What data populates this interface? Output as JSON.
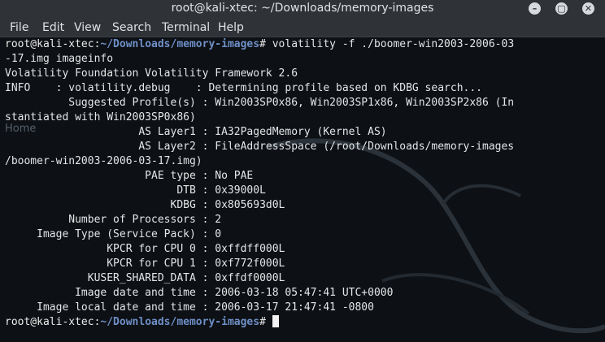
{
  "window": {
    "title": "root@kali-xtec: ~/Downloads/memory-images",
    "controls": {
      "minimize": "–",
      "maximize": "▢",
      "close": "✕"
    }
  },
  "menu": [
    "File",
    "Edit",
    "View",
    "Search",
    "Terminal",
    "Help"
  ],
  "desktop": {
    "ghost_label": "Home"
  },
  "terminal": {
    "prompt_user": "root@kali-xtec",
    "prompt_path": "~/Downloads/memory-images",
    "prompt_symbol": "#",
    "command_line1": " volatility -f ./boomer-win2003-2006-03",
    "command_line2": "-17.img imageinfo",
    "output": [
      "Volatility Foundation Volatility Framework 2.6",
      "INFO    : volatility.debug    : Determining profile based on KDBG search...",
      "          Suggested Profile(s) : Win2003SP0x86, Win2003SP1x86, Win2003SP2x86 (In",
      "stantiated with Win2003SP0x86)",
      "                     AS Layer1 : IA32PagedMemory (Kernel AS)",
      "                     AS Layer2 : FileAddressSpace (/root/Downloads/memory-images",
      "/boomer-win2003-2006-03-17.img)",
      "                      PAE type : No PAE",
      "                           DTB : 0x39000L",
      "                          KDBG : 0x805693d0L",
      "          Number of Processors : 2",
      "     Image Type (Service Pack) : 0",
      "                KPCR for CPU 0 : 0xffdff000L",
      "                KPCR for CPU 1 : 0xf772f000L",
      "             KUSER_SHARED_DATA : 0xffdf0000L",
      "           Image date and time : 2006-03-18 05:47:41 UTC+0000",
      "     Image local date and time : 2006-03-17 21:47:41 -0800"
    ]
  }
}
